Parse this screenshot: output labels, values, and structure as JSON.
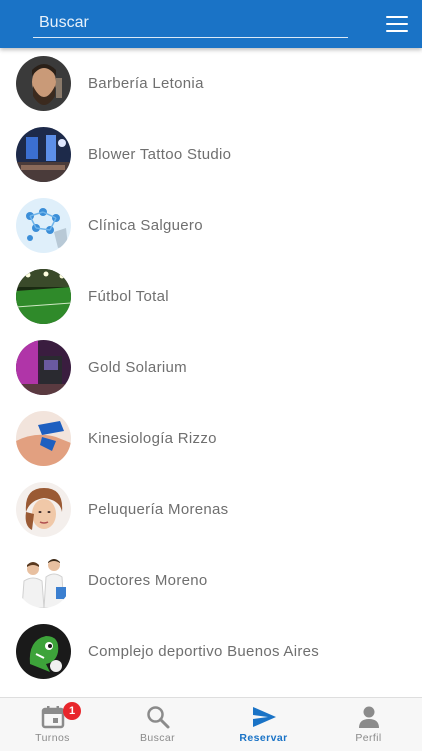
{
  "header": {
    "search_placeholder": "Buscar",
    "menu_icon": "hamburger-menu-icon",
    "bar_color": "#1a73c6"
  },
  "businesses": [
    {
      "name": "Barbería Letonia",
      "avatar": "barber-portrait"
    },
    {
      "name": "Blower Tattoo Studio",
      "avatar": "tattoo-studio-interior"
    },
    {
      "name": "Clínica Salguero",
      "avatar": "medical-network-graphic"
    },
    {
      "name": "Fútbol Total",
      "avatar": "football-field"
    },
    {
      "name": "Gold Solarium",
      "avatar": "solarium-room"
    },
    {
      "name": "Kinesiología Rizzo",
      "avatar": "kinesio-tape-hand"
    },
    {
      "name": "Peluquería Morenas",
      "avatar": "hairstyle-woman"
    },
    {
      "name": "Doctores Moreno",
      "avatar": "doctors-pair"
    },
    {
      "name": "Complejo deportivo Buenos Aires",
      "avatar": "sports-complex-logo"
    }
  ],
  "tabs": [
    {
      "label": "Turnos",
      "icon": "calendar-icon",
      "badge": "1"
    },
    {
      "label": "Buscar",
      "icon": "search-icon"
    },
    {
      "label": "Reservar",
      "icon": "send-icon",
      "active": true
    },
    {
      "label": "Perfil",
      "icon": "person-icon"
    }
  ],
  "colors": {
    "accent": "#1a73c6",
    "badge": "#e8262b",
    "text": "#6f6f6f"
  }
}
